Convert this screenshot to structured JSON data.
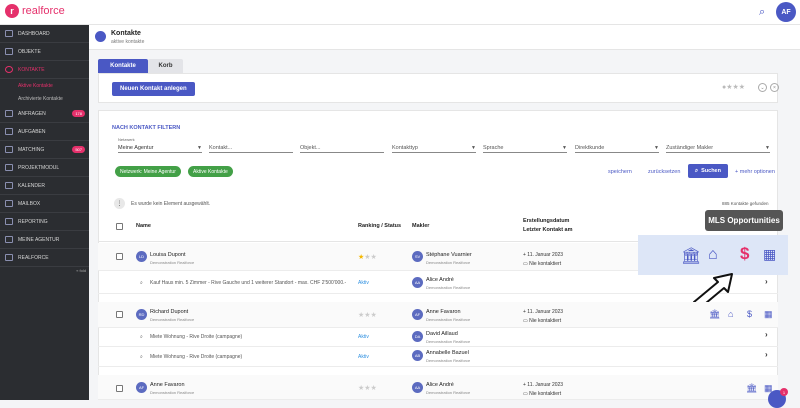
{
  "app": {
    "logo_text": "realforce",
    "avatar_initials": "AF"
  },
  "sidebar": {
    "items": [
      {
        "label": "Dashboard"
      },
      {
        "label": "Objekte"
      },
      {
        "label": "Kontakte"
      },
      {
        "label": "Anfragen",
        "badge": "178"
      },
      {
        "label": "Aufgaben"
      },
      {
        "label": "Matching",
        "badge": "507"
      },
      {
        "label": "Projektmodul"
      },
      {
        "label": "Kalender"
      },
      {
        "label": "Mailbox"
      },
      {
        "label": "Reporting"
      },
      {
        "label": "Meine Agentur"
      },
      {
        "label": "Realforce"
      }
    ],
    "sub_items": [
      {
        "label": "Aktive Kontakte"
      },
      {
        "label": "Archivierte Kontakte"
      }
    ],
    "collapse": "« fold"
  },
  "header": {
    "title": "Kontakte",
    "subtitle": "aktive kontakte"
  },
  "tabs": [
    {
      "label": "Kontakte"
    },
    {
      "label": "Korb"
    }
  ],
  "actions": {
    "new_contact": "Neuen Kontakt anlegen"
  },
  "filter": {
    "title": "Nach Kontakt filtern",
    "network_label": "Netzwerk",
    "network_value": "Meine Agentur",
    "kontakt": "Kontakt...",
    "objekt": "Objekt...",
    "kontakttyp": "Kontakttyp",
    "sprache": "Sprache",
    "direktkunde": "Direktkunde",
    "makler": "Zuständiger Makler",
    "chips": [
      "Netzwerk: Meine Agentur",
      "Aktive Kontakte"
    ],
    "save": "speichern",
    "reset": "zurücksetzen",
    "search": "Suchen",
    "more": "+ mehr optionen"
  },
  "table": {
    "selection_info": "Es wurde kein Element ausgewählt.",
    "found": "885 Kontakte gefunden",
    "headers": {
      "name": "Name",
      "ranking": "Ranking / Status",
      "makler": "Makler",
      "date1": "Erstellungsdatum",
      "date2": "Letzter Kontakt am"
    },
    "rows": [
      {
        "initials": "LD",
        "name": "Louisa Dupont",
        "org": "Demonstration Realforce",
        "agent_initials": "SV",
        "agent": "Stéphane Vuarnier",
        "agent_org": "Demonstration Realforce",
        "created": "+ 11. Januar 2023",
        "last": "Nie kontaktiert",
        "subrows": [
          {
            "text": "Kauf Haus min. 5 Zimmer - Rive Gauche und 1 weiterer Standort - max. CHF 2'500'000.-",
            "status": "Aktiv",
            "agent_initials": "AA",
            "agent": "Alice André",
            "agent_org": "Demonstration Realforce"
          }
        ]
      },
      {
        "initials": "RD",
        "name": "Richard Dupont",
        "org": "Demonstration Realforce",
        "agent_initials": "AF",
        "agent": "Anne Favaron",
        "agent_org": "Demonstration Realforce",
        "created": "+ 11. Januar 2023",
        "last": "Nie kontaktiert",
        "subrows": [
          {
            "text": "Miete Wohnung - Rive Droite (campagne)",
            "status": "Aktiv",
            "agent_initials": "DA",
            "agent": "David Aillaud",
            "agent_org": "Demonstration Realforce"
          },
          {
            "text": "Miete Wohnung - Rive Droite (campagne)",
            "status": "Aktiv",
            "agent_initials": "AB",
            "agent": "Annabelle Bazuel",
            "agent_org": "Demonstration Realforce"
          }
        ]
      },
      {
        "initials": "AF",
        "name": "Anne Favaron",
        "org": "Demonstration Realforce",
        "agent_initials": "AA",
        "agent": "Alice André",
        "agent_org": "Demonstration Realforce",
        "created": "+ 11. Januar 2023",
        "last": "Nie kontaktiert",
        "subrows": []
      }
    ]
  },
  "overlay": {
    "tooltip": "MLS Opportunities"
  },
  "icons": [
    "bank-icon",
    "house-icon",
    "dollar-icon",
    "calendar-icon",
    "search-icon",
    "chevron-right-icon"
  ],
  "colors": {
    "brand": "#e5306b",
    "accent": "#4a58c4",
    "chip": "#43a047"
  },
  "notification_count": "1"
}
